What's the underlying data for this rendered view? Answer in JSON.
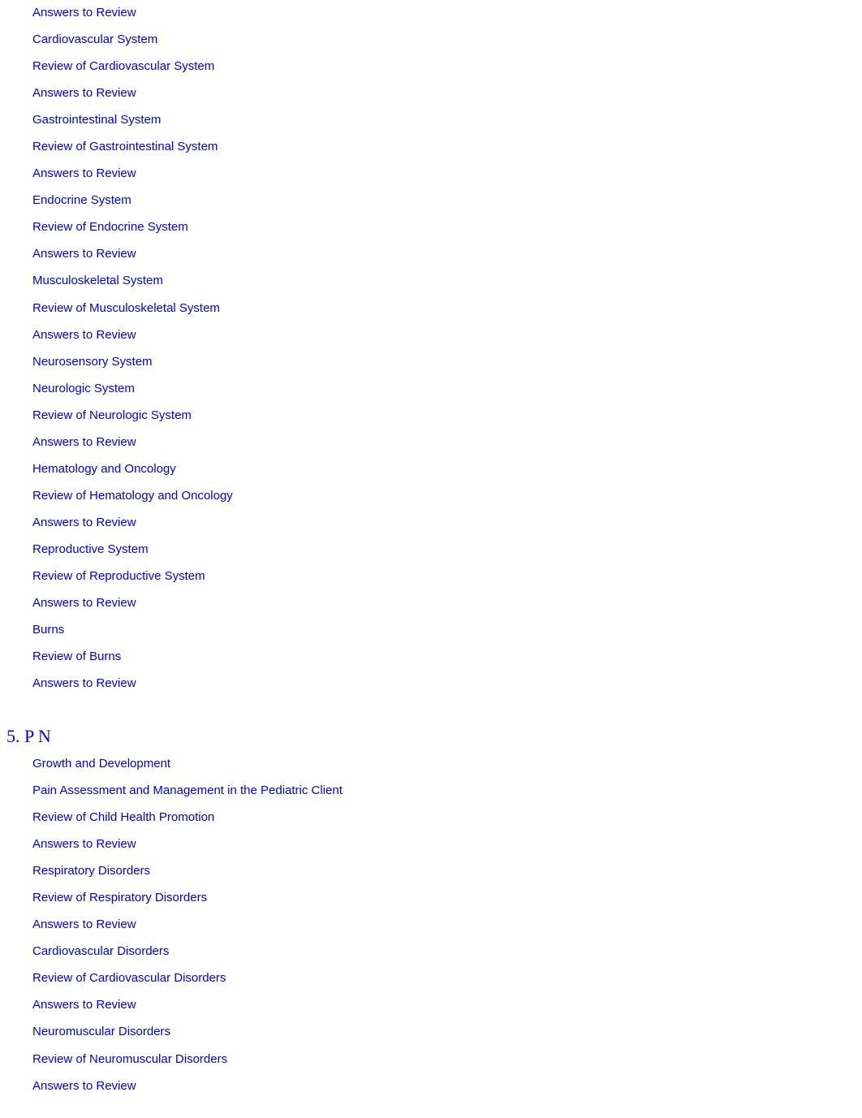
{
  "accent_color": "#0000ee",
  "section_a": {
    "items": [
      "Answers to Review",
      "Cardiovascular System",
      "Review of Cardiovascular System",
      "Answers to Review",
      "Gastrointestinal System",
      "Review of Gastrointestinal System",
      "Answers to Review",
      "Endocrine System",
      "Review of Endocrine System",
      "Answers to Review",
      "Musculoskeletal System",
      "Review of Musculoskeletal System",
      "Answers to Review",
      "Neurosensory System",
      "Neurologic System",
      "Review of Neurologic System",
      "Answers to Review",
      "Hematology and Oncology",
      "Review of Hematology and Oncology",
      "Answers to Review",
      "Reproductive System",
      "Review of Reproductive System",
      "Answers to Review",
      "Burns",
      "Review of Burns",
      "Answers to Review"
    ]
  },
  "section_b": {
    "heading": "5. P N",
    "items": [
      "Growth and Development",
      "Pain Assessment and Management in the Pediatric Client",
      "Review of Child Health Promotion",
      "Answers to Review",
      "Respiratory Disorders",
      "Review of Respiratory Disorders",
      "Answers to Review",
      "Cardiovascular Disorders",
      "Review of Cardiovascular Disorders",
      "Answers to Review",
      "Neuromuscular Disorders",
      "Review of Neuromuscular Disorders",
      "Answers to Review"
    ]
  }
}
